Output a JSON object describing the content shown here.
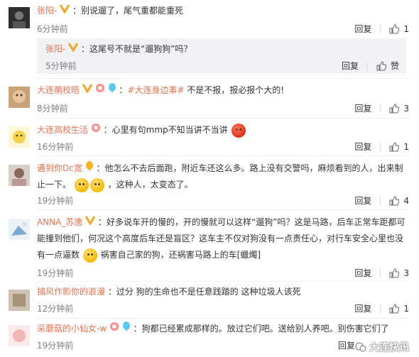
{
  "colors": {
    "username": "#eb7350",
    "text": "#333333",
    "time": "#808080",
    "nested_bg": "#f2f2f5"
  },
  "comments": [
    {
      "user": "张阳-",
      "text": "：别说遛了，尾气重都能重死",
      "time": "6分钟前",
      "reply": "回复",
      "likes": "1"
    },
    {
      "user": "张阳-",
      "text": "：这尾号不就是“遛狗狗”吗？",
      "time": "5分钟前",
      "reply": "回复",
      "like_label": "赞"
    },
    {
      "user": "大连萌校晤",
      "tag": "#大连身边事#",
      "text": "不是不报，报必报个大的!",
      "time": "8分钟前",
      "reply": "回复",
      "likes": "3"
    },
    {
      "user": "大连高校生活",
      "text": "：心里有句mmp不知当讲不当讲",
      "time": "16分钟前",
      "reply": "回复",
      "likes": "1"
    },
    {
      "user": "遇到你Dc宽",
      "text_1": "：他怎么不去后面跑，附近车还这么多。路上没有交警吗，麻烦看到的人，出来制",
      "text_2": "止一下。",
      "text_3": "，这种人，太变态了。",
      "time": "19分钟前",
      "reply": "回复",
      "likes": "4"
    },
    {
      "user": "ANNA_苏唐",
      "text_1": "：好多说车开的慢的，开的慢就可以这样“遛狗”吗？这是马路，后车正常车距都可",
      "text_2": "能撞到他们，何况这个高度后车还是盲区？这车主不仅对狗没有一点责任心，对行车安全心里也没",
      "text_3a": "有一点逼数",
      "text_3b": "祸害自己家的狗，还祸害马路上的车[蠟燭]",
      "time": "19分钟前",
      "reply": "回复",
      "likes": "3"
    },
    {
      "user": "捕风作影你的浪漫",
      "text": "：过分 狗的生命也不是任意践踏的 这种垃圾人该死",
      "time": "12分钟前",
      "reply": "回复",
      "likes": "1"
    },
    {
      "user": "采蘑菇的小仙女-w",
      "text": "：狗都已经累成那样的。放过它们吧。送给别人养吧。别伤害它们了",
      "time": "19分钟前",
      "reply": "回复"
    }
  ],
  "watermark": "大连快讯"
}
